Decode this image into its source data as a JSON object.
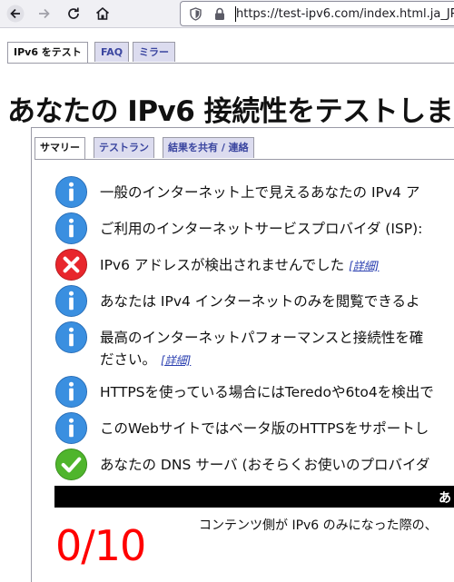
{
  "browser": {
    "url": "https://test-ipv6.com/index.html.ja_JP"
  },
  "top_tabs": [
    {
      "label": "IPv6 をテスト",
      "active": true
    },
    {
      "label": "FAQ",
      "active": false
    },
    {
      "label": "ミラー",
      "active": false
    }
  ],
  "page_title": "あなたの IPv6 接続性をテストしま",
  "inner_tabs": [
    {
      "label": "サマリー",
      "active": true
    },
    {
      "label": "テストラン",
      "active": false
    },
    {
      "label": "結果を共有 / 連絡",
      "active": false
    }
  ],
  "results": [
    {
      "icon": "info",
      "text": "一般のインターネット上で見えるあなたの IPv4 ア"
    },
    {
      "icon": "info",
      "text": "ご利用のインターネットサービスプロバイダ (ISP):"
    },
    {
      "icon": "error",
      "text": "IPv6 アドレスが検出されませんでした",
      "link": "[詳細]"
    },
    {
      "icon": "info",
      "text": "あなたは IPv4 インターネットのみを閲覧できるよ"
    },
    {
      "icon": "info",
      "text": "最高のインターネットパフォーマンスと接続性を確",
      "text2": "ださい。",
      "link": "[詳細]"
    },
    {
      "icon": "info",
      "text": "HTTPSを使っている場合にはTeredoや6to4を検出で"
    },
    {
      "icon": "info",
      "text": "このWebサイトではベータ版のHTTPSをサポートし"
    },
    {
      "icon": "ok",
      "text": "あなたの DNS サーバ (おそらくお使いのプロバイダ"
    }
  ],
  "score_bar_text": "あ",
  "score": "0/10",
  "score_note": "コンテンツ側が IPv6 のみになった際の、",
  "colors": {
    "info_blue": "#3a8fe0",
    "error_red": "#e8262c",
    "ok_green": "#4fb52c",
    "score_red": "#ff0000",
    "tab_inactive_bg": "#dcdcef",
    "tab_inactive_text": "#3b46a0"
  }
}
